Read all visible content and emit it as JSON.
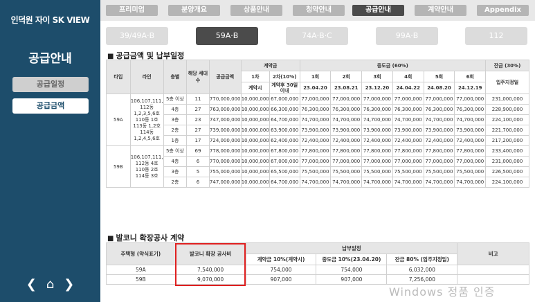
{
  "sidebar": {
    "brand": "인덕원 자이 SK VIEW",
    "title": "공급안내",
    "menu_inactive": "공급일정",
    "menu_active": "공급금액"
  },
  "tabs": [
    "프리미엄",
    "분양개요",
    "상품안내",
    "청약안내",
    "공급안내",
    "계약안내",
    "Appendix"
  ],
  "active_tab": "공급안내",
  "subtabs": [
    "39/49A·B",
    "59A·B",
    "74A·B·C",
    "99A·B",
    "112"
  ],
  "active_subtab": "59A·B",
  "section1": {
    "title": "공급금액 및 납부일정",
    "headers": {
      "type": "타입",
      "line": "라인",
      "floor": "층별",
      "units": "해당 세대수",
      "price": "공급금액",
      "deposit": "계약금",
      "mid": "중도금 (60%)",
      "balance": "잔금 (30%)",
      "d1": "1차",
      "d2": "2차(10%)",
      "m1": "1회",
      "m2": "2회",
      "m3": "3회",
      "m4": "4회",
      "m5": "5회",
      "m6": "6회",
      "d1_sub": "계약시",
      "d2_sub": "계약후 30일 이내",
      "m1_date": "23.04.20",
      "m2_date": "23.08.21",
      "m3_date": "23.12.20",
      "m4_date": "24.04.22",
      "m5_date": "24.08.20",
      "m6_date": "24.12.19",
      "balance_sub": "입주지정일"
    },
    "groups": [
      {
        "type": "59A",
        "line": "106,107,111, 112동 1,2,3,5,6호 110동 1호 113동 1,2호 114동 1,2,4,5,6호",
        "rows": [
          [
            "5층 이상",
            "11",
            "770,000,000",
            "10,000,000",
            "67,000,000",
            "77,000,000",
            "77,000,000",
            "77,000,000",
            "77,000,000",
            "77,000,000",
            "77,000,000",
            "231,000,000"
          ],
          [
            "4층",
            "27",
            "763,000,000",
            "10,000,000",
            "66,300,000",
            "76,300,000",
            "76,300,000",
            "76,300,000",
            "76,300,000",
            "76,300,000",
            "76,300,000",
            "228,900,000"
          ],
          [
            "3층",
            "23",
            "747,000,000",
            "10,000,000",
            "64,700,000",
            "74,700,000",
            "74,700,000",
            "74,700,000",
            "74,700,000",
            "74,700,000",
            "74,700,000",
            "224,100,000"
          ],
          [
            "2층",
            "27",
            "739,000,000",
            "10,000,000",
            "63,900,000",
            "73,900,000",
            "73,900,000",
            "73,900,000",
            "73,900,000",
            "73,900,000",
            "73,900,000",
            "221,700,000"
          ],
          [
            "1층",
            "17",
            "724,000,000",
            "10,000,000",
            "62,400,000",
            "72,400,000",
            "72,400,000",
            "72,400,000",
            "72,400,000",
            "72,400,000",
            "72,400,000",
            "217,200,000"
          ]
        ]
      },
      {
        "type": "59B",
        "line": "106,107,111, 112동 4호 110동 2호 114동 3호",
        "rows": [
          [
            "5층 이상",
            "69",
            "778,000,000",
            "10,000,000",
            "67,800,000",
            "77,800,000",
            "77,800,000",
            "77,800,000",
            "77,800,000",
            "77,800,000",
            "77,800,000",
            "233,400,000"
          ],
          [
            "4층",
            "6",
            "770,000,000",
            "10,000,000",
            "67,000,000",
            "77,000,000",
            "77,000,000",
            "77,000,000",
            "77,000,000",
            "77,000,000",
            "77,000,000",
            "231,000,000"
          ],
          [
            "3층",
            "5",
            "755,000,000",
            "10,000,000",
            "65,500,000",
            "75,500,000",
            "75,500,000",
            "75,500,000",
            "75,500,000",
            "75,500,000",
            "75,500,000",
            "226,500,000"
          ],
          [
            "2층",
            "6",
            "747,000,000",
            "10,000,000",
            "64,700,000",
            "74,700,000",
            "74,700,000",
            "74,700,000",
            "74,700,000",
            "74,700,000",
            "74,700,000",
            "224,100,000"
          ]
        ]
      }
    ]
  },
  "section2": {
    "title": "발코니 확장공사 계약",
    "headers": {
      "type": "주택형 (약식표기)",
      "cost": "발코니 확장 공사비",
      "schedule": "납부일정",
      "deposit": "계약금 10%(계약시)",
      "mid": "중도금 10%(23.04.20)",
      "balance": "잔금 80% (입주지정일)",
      "note": "비고"
    },
    "rows": [
      {
        "type": "59A",
        "cost": "7,540,000",
        "deposit": "754,000",
        "mid": "754,000",
        "balance": "6,032,000",
        "note": ""
      },
      {
        "type": "59B",
        "cost": "9,070,000",
        "deposit": "907,000",
        "mid": "907,000",
        "balance": "7,256,000",
        "note": ""
      }
    ]
  },
  "nav": {
    "prev": "❮",
    "home": "⌂",
    "next": "❯"
  },
  "watermark": "Windows 정품 인증"
}
